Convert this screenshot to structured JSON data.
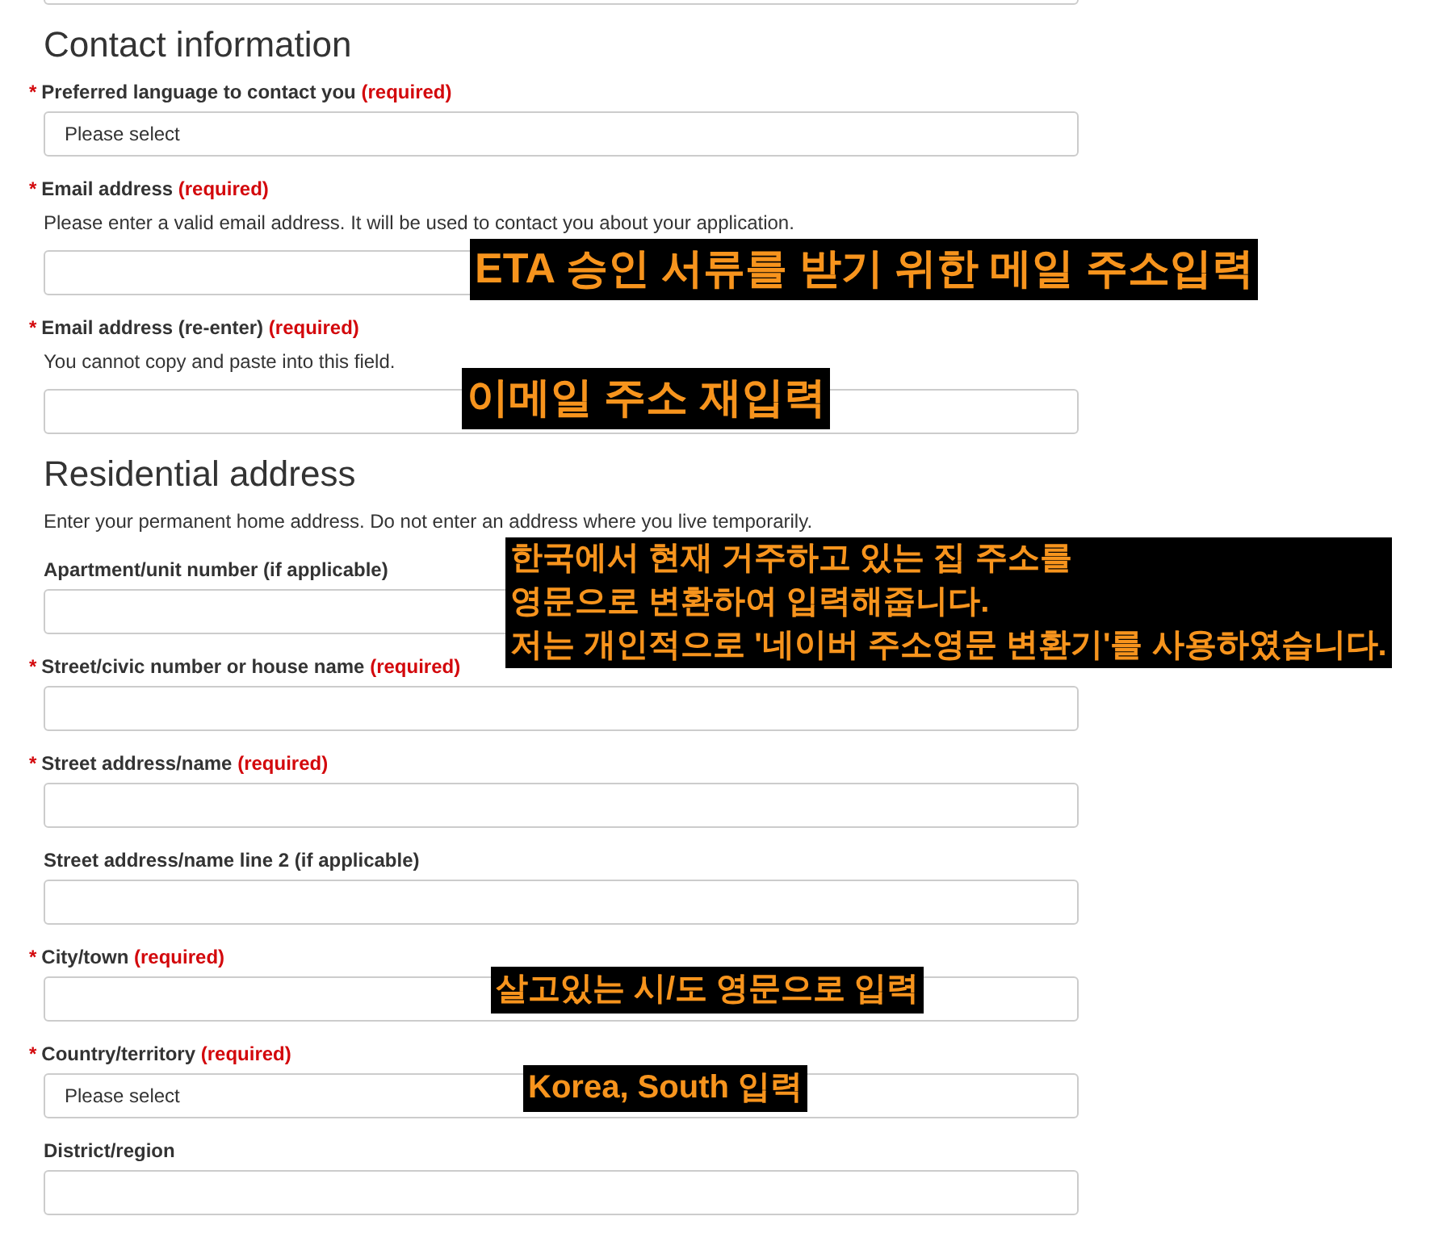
{
  "sections": [
    {
      "fields": [
        {
          "kind": "input"
        }
      ]
    },
    {
      "heading": "Contact information",
      "fields": [
        {
          "kind": "select",
          "marker": "*",
          "label": "Preferred language to contact you",
          "required_text": "(required)",
          "value": "Please select"
        },
        {
          "kind": "input",
          "marker": "*",
          "label": "Email address",
          "required_text": "(required)",
          "hint": "Please enter a valid email address. It will be used to contact you about your application."
        },
        {
          "kind": "input",
          "marker": "*",
          "label": "Email address (re-enter)",
          "required_text": "(required)",
          "hint": "You cannot copy and paste into this field."
        }
      ]
    },
    {
      "heading": "Residential address",
      "intro": "Enter your permanent home address. Do not enter an address where you live temporarily.",
      "fields": [
        {
          "kind": "input",
          "label": "Apartment/unit number (if applicable)"
        },
        {
          "kind": "input",
          "marker": "*",
          "label": "Street/civic number or house name",
          "required_text": "(required)"
        },
        {
          "kind": "input",
          "marker": "*",
          "label": "Street address/name",
          "required_text": "(required)"
        },
        {
          "kind": "input",
          "label": "Street address/name line 2 (if applicable)"
        },
        {
          "kind": "input",
          "marker": "*",
          "label": "City/town",
          "required_text": "(required)"
        },
        {
          "kind": "select",
          "marker": "*",
          "label": "Country/territory",
          "required_text": "(required)",
          "value": "Please select"
        },
        {
          "kind": "input",
          "label": "District/region"
        }
      ]
    }
  ],
  "annotations": [
    {
      "lines": [
        "ETA 승인 서류를 받기 위한 메일 주소입력"
      ]
    },
    {
      "lines": [
        "이메일 주소 재입력"
      ]
    },
    {
      "lines": [
        "한국에서 현재 거주하고 있는 집 주소를",
        "영문으로 변환하여 입력해줍니다.",
        "저는 개인적으로 '네이버 주소영문 변환기'를 사용하였습니다."
      ]
    },
    {
      "lines": [
        "살고있는 시/도 영문으로 입력"
      ]
    },
    {
      "lines": [
        "Korea, South 입력"
      ]
    }
  ]
}
